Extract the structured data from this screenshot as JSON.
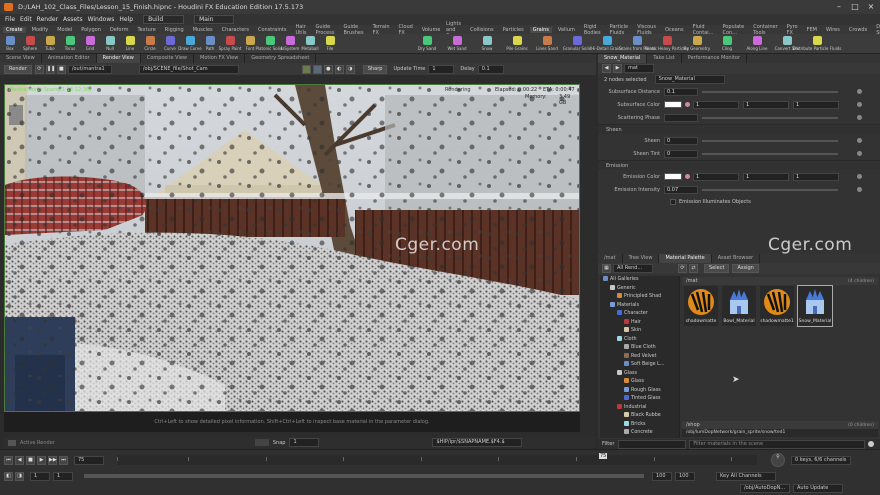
{
  "window": {
    "title": "D:/LAH_102_Class_Files/Lesson_15_Finish.hipnc - Houdini FX Education Edition 17.5.173"
  },
  "menu": {
    "items": [
      "File",
      "Edit",
      "Render",
      "Assets",
      "Windows",
      "Help"
    ],
    "desktop": "Build",
    "shelf_set": "Main"
  },
  "shelf": {
    "left_tabs": [
      "Create",
      "Modify",
      "Model",
      "Polygon",
      "Deform",
      "Texture",
      "Rigging",
      "Muscles",
      "Characters",
      "Constraints",
      "Hair Utils",
      "Guide Process",
      "Guide Brushes",
      "Terrain FX",
      "Cloud FX",
      "Volume"
    ],
    "right_tabs": [
      "Lights and C...",
      "Collisions",
      "Particles",
      "Grains",
      "Vellum",
      "Rigid Bodies",
      "Particle Fluids",
      "Viscous Fluids",
      "Oceans",
      "Fluid Contai...",
      "Populate Con...",
      "Container Tools",
      "Pyro FX",
      "FEM",
      "Wires",
      "Crowds",
      "Drive Simula..."
    ],
    "left_tools": [
      "Box",
      "Sphere",
      "Tube",
      "Torus",
      "Grid",
      "Null",
      "Line",
      "Circle",
      "Curve",
      "Draw Curve",
      "Path",
      "Spray Paint",
      "Font",
      "Platonic Solids",
      "L-System",
      "Metaball",
      "File"
    ],
    "right_tools": [
      "Dry Sand",
      "Wet Sand",
      "Snow",
      "Pile Grains",
      "Lines Sand",
      "Granular Solid",
      "Hi-Detail Grains",
      "Grains from Points",
      "Break Heavy Particles",
      "By Geometry",
      "Cling",
      "Along Line",
      "Convert Sim",
      "Distribute Particle Fluids"
    ]
  },
  "viewer": {
    "tabs": [
      "Scene View",
      "Animation Editor",
      "Render View",
      "Composite View",
      "Motion FX View",
      "Geometry Spreadsheet"
    ],
    "active_tab": "Render View",
    "render_button": "Render",
    "driver_path": "/out/mantra1",
    "camera_path": "/obj/SCENE_file/Shot_Cam",
    "sharp_button": "Sharp",
    "update_time_label": "Update Time",
    "update_time_value": "1",
    "delay_label": "Delay",
    "delay_value": "0.1",
    "overlay_title": "[Mantra(hdr2):Sparky.1:13:12:36]",
    "render_mode": "Rendering",
    "elapsed": "Elapsed: 0:00:22",
    "eta": "ETA: 0:00:47",
    "memory": "Memory:",
    "memory_value": "3.49 GB",
    "status_hint": "Ctrl+Left to show detailed pixel information. Shift+Ctrl+Left to inspect base material in the parameter dialog.",
    "snap_label": "Snap",
    "snap_value": "1",
    "ip_path": "$HIP/ipr/$SNAPNAME.$F4.$"
  },
  "params": {
    "tabs": [
      "Snow_Material",
      "Take List",
      "Performance Monitor"
    ],
    "path": "mat",
    "header": "2 nodes selected",
    "node_name": "Snow_Material",
    "rows_top": [
      {
        "label": "Subsurface Distance",
        "value": "0.1"
      },
      {
        "label": "Subsurface Color",
        "value": "",
        "r": "1",
        "g": "1",
        "b": "1"
      },
      {
        "label": "Scattering Phase",
        "value": ""
      }
    ],
    "sheen_section": "Sheen",
    "sheen_rows": [
      {
        "label": "Sheen",
        "value": "0"
      },
      {
        "label": "Sheen Tint",
        "value": "0"
      }
    ],
    "emission_section": "Emission",
    "emission_rows": [
      {
        "label": "Emission Color",
        "value": "",
        "r": "1",
        "g": "1",
        "b": "1"
      },
      {
        "label": "Emission Intensity",
        "value": "0.07"
      }
    ],
    "emission_illum": "Emission Illuminates Objects"
  },
  "material_palette": {
    "tabs": [
      "/mat",
      "Tree View",
      "Material Palette",
      "Asset Browser"
    ],
    "all_renderers": "All Rend...",
    "select_button": "Select",
    "assign_button": "Assign",
    "context": "/mat",
    "count": "(4 children)",
    "tree": [
      {
        "label": "All Galleries",
        "depth": 0
      },
      {
        "label": "Generic",
        "depth": 1
      },
      {
        "label": "Principled Shad",
        "depth": 2
      },
      {
        "label": "Materials",
        "depth": 1
      },
      {
        "label": "Character",
        "depth": 2
      },
      {
        "label": "Hair",
        "depth": 3
      },
      {
        "label": "Skin",
        "depth": 3
      },
      {
        "label": "Cloth",
        "depth": 2
      },
      {
        "label": "Blue Cloth",
        "depth": 3
      },
      {
        "label": "Red Velvet",
        "depth": 3
      },
      {
        "label": "Soft Beige L...",
        "depth": 3
      },
      {
        "label": "Glass",
        "depth": 2
      },
      {
        "label": "Glass",
        "depth": 3
      },
      {
        "label": "Rough Glass",
        "depth": 3
      },
      {
        "label": "Tinted Glass",
        "depth": 3
      },
      {
        "label": "Industrial",
        "depth": 2
      },
      {
        "label": "Black Rubbe",
        "depth": 3
      },
      {
        "label": "Bricks",
        "depth": 3
      },
      {
        "label": "Concrete",
        "depth": 3
      }
    ],
    "materials": [
      "shadowmatte",
      "Bowl_Material",
      "shadowmatte1",
      "Snow_Material"
    ],
    "footer_path": "/obj/lumDopNetwork/grain_sprite/snow/ted1",
    "footer_context": "/shop",
    "footer_children": "(0 children)",
    "filter_label": "Filter",
    "filter_placeholder": "Filter materials in the scene"
  },
  "timeline": {
    "frame": "75",
    "start": "1",
    "start2": "1",
    "end": "100",
    "end2": "100",
    "ticks": [
      "1",
      "12",
      "24",
      "36",
      "48",
      "60",
      "72",
      "84",
      "96"
    ],
    "current_tick": "75",
    "keys_channels": "0 keys, 6/6 channels",
    "key_all": "Key All Channels",
    "auto_update": "Auto Update",
    "obj_path": "/obj/AutoDopN..."
  },
  "watermarks": [
    "Cger.com",
    "Cger.com"
  ],
  "colors": {
    "accent": "#e07020",
    "viewport_border": "#4a7a3a",
    "overlay_text": "#7adf5c"
  }
}
